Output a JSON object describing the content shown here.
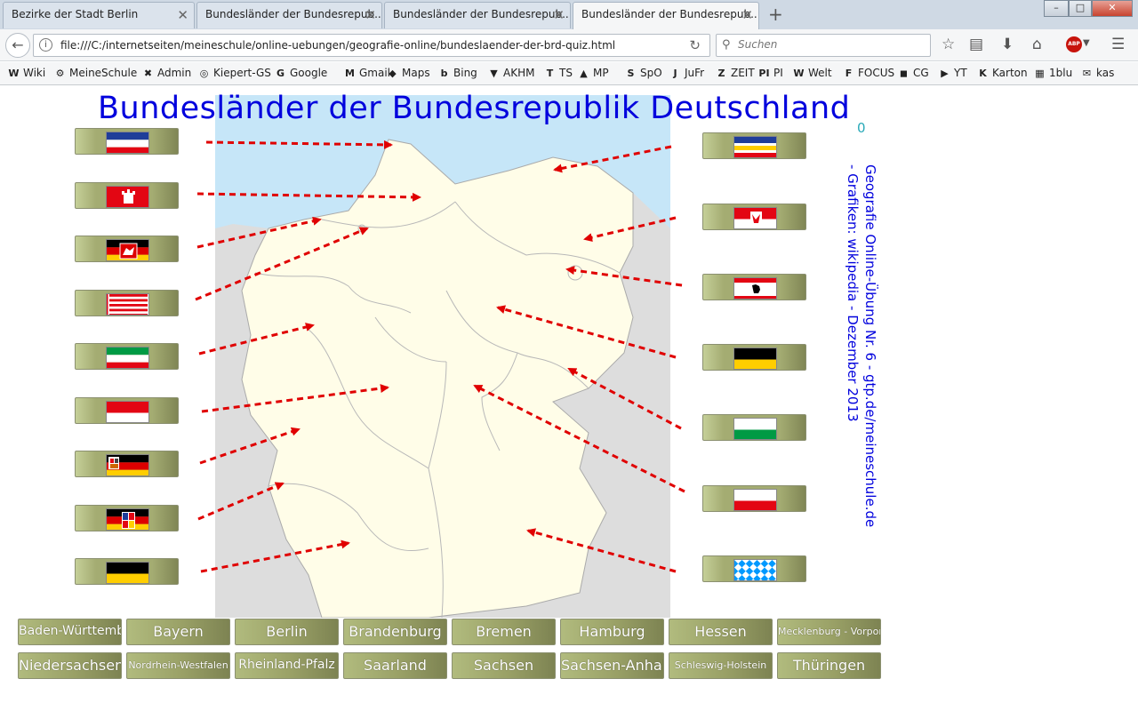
{
  "browser": {
    "tabs": [
      {
        "label": "Bezirke der Stadt Berlin",
        "active": false
      },
      {
        "label": "Bundesländer der Bundesrepub...",
        "active": false
      },
      {
        "label": "Bundesländer der Bundesrepub...",
        "active": false
      },
      {
        "label": "Bundesländer der Bundesrepub...",
        "active": true
      }
    ],
    "url": "file:///C:/internetseiten/meineschule/online-uebungen/geografie-online/bundeslaender-der-brd-quiz.html",
    "search_placeholder": "Suchen",
    "adblock_label": "ABP",
    "bookmarks": [
      {
        "icon": "W",
        "label": "Wiki"
      },
      {
        "icon": "⚙",
        "label": "MeineSchule"
      },
      {
        "icon": "✖",
        "label": "Admin"
      },
      {
        "icon": "◎",
        "label": "Kiepert-GS"
      },
      {
        "icon": "G",
        "label": "Google"
      },
      {
        "icon": "M",
        "label": "Gmail"
      },
      {
        "icon": "◆",
        "label": "Maps"
      },
      {
        "icon": "b",
        "label": "Bing"
      },
      {
        "icon": "▼",
        "label": "AKHM"
      },
      {
        "icon": "T",
        "label": "TS"
      },
      {
        "icon": "▲",
        "label": "MP"
      },
      {
        "icon": "S",
        "label": "SpO"
      },
      {
        "icon": "J",
        "label": "JuFr"
      },
      {
        "icon": "Z",
        "label": "ZEIT"
      },
      {
        "icon": "PI",
        "label": "PI"
      },
      {
        "icon": "W",
        "label": "Welt"
      },
      {
        "icon": "F",
        "label": "FOCUS"
      },
      {
        "icon": "◼",
        "label": "CG"
      },
      {
        "icon": "▶",
        "label": "YT"
      },
      {
        "icon": "K",
        "label": "Karton"
      },
      {
        "icon": "▦",
        "label": "1blu"
      },
      {
        "icon": "✉",
        "label": "kas"
      }
    ]
  },
  "quiz": {
    "title": "Bundesländer der Bundesrepublik Deutschland",
    "score": "0",
    "credit_line1": "Geografie Online-Übung Nr. 6 - gtp.de/meineschule.de",
    "credit_line2": "- Grafiken: wikipedia - Dezember 2013",
    "flags_left": [
      "schleswig-holstein",
      "hamburg",
      "niedersachsen",
      "bremen",
      "nordrhein-westfalen",
      "hessen",
      "rheinland-pfalz",
      "saarland",
      "baden-wuerttemberg"
    ],
    "flags_right": [
      "mecklenburg-vorpommern",
      "brandenburg",
      "berlin",
      "sachsen-anhalt",
      "sachsen",
      "thueringen",
      "bayern"
    ],
    "state_buttons": [
      "Baden-Württemberg",
      "Bayern",
      "Berlin",
      "Brandenburg",
      "Bremen",
      "Hamburg",
      "Hessen",
      "Mecklenburg - Vorpommern",
      "Niedersachsen",
      "Nordrhein-Westfalen",
      "Rheinland-Pfalz",
      "Saarland",
      "Sachsen",
      "Sachsen-Anhalt",
      "Schleswig-Holstein",
      "Thüringen"
    ]
  },
  "colors": {
    "title": "#0000dd",
    "arrow": "#e00000",
    "sea": "#c6e6f8",
    "land": "#fffde8"
  }
}
